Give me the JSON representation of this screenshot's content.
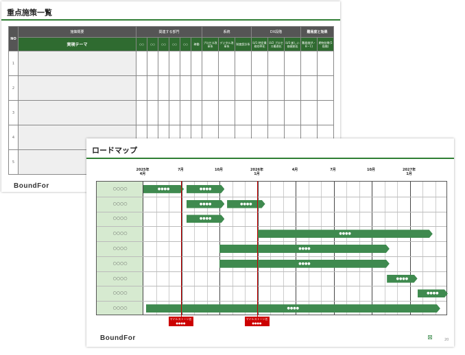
{
  "slide1": {
    "title": "重点施策一覧",
    "logo": "BoundFor",
    "headers": {
      "no": "NO",
      "measure": "施策概要",
      "theme": "実現テーマ",
      "dept": "関連する部門",
      "system": "系統",
      "dx": "DX段階",
      "difficulty": "難易度と効果"
    },
    "dept_cols": [
      "○○",
      "○○",
      "○○",
      "○○",
      "○○",
      "稼働"
    ],
    "system_cols": [
      "プロセス改革系",
      "デジタル改革系",
      "制度設計系"
    ],
    "dx_cols": [
      "LV1 特定業務効率化",
      "LV2 プロセス最適化",
      "LV3 新しい価値創出"
    ],
    "difficulty_cols": [
      "難易度(A・B・C)",
      "期待効果(5段階)"
    ],
    "rows": [
      "1",
      "2",
      "3",
      "4",
      "5"
    ]
  },
  "slide2": {
    "title": "ロードマップ",
    "logo": "BoundFor",
    "page_number": "20",
    "months": [
      "2025年\n4月",
      "7月",
      "10月",
      "2026年\n1月",
      "4月",
      "7月",
      "10月",
      "2027年\n1月"
    ],
    "row_labels": [
      "○○○○",
      "○○○○",
      "○○○○",
      "○○○○",
      "○○○○",
      "○○○○",
      "○○○○",
      "○○○○",
      "○○○○"
    ],
    "bars": [
      {
        "row": 0,
        "start": 0,
        "end": 3.2,
        "label": "●●●●"
      },
      {
        "row": 0,
        "start": 3.4,
        "end": 6.4,
        "label": "●●●●"
      },
      {
        "row": 1,
        "start": 3.4,
        "end": 6.4,
        "label": "●●●●"
      },
      {
        "row": 1,
        "start": 6.6,
        "end": 9.6,
        "label": "●●●●"
      },
      {
        "row": 2,
        "start": 3.4,
        "end": 6.4,
        "label": "●●●●"
      },
      {
        "row": 3,
        "start": 9.0,
        "end": 22.8,
        "label": "●●●●"
      },
      {
        "row": 4,
        "start": 6.0,
        "end": 19.4,
        "label": "●●●●"
      },
      {
        "row": 5,
        "start": 6.0,
        "end": 19.4,
        "label": "●●●●"
      },
      {
        "row": 6,
        "start": 19.2,
        "end": 21.6,
        "label": "●●●●"
      },
      {
        "row": 7,
        "start": 21.6,
        "end": 24.0,
        "label": "●●●●"
      },
      {
        "row": 8,
        "start": 0.2,
        "end": 23.4,
        "label": "●●●●"
      }
    ],
    "milestones": [
      {
        "at": 3.0,
        "label": "マイルストーン名",
        "sub": "●●●●"
      },
      {
        "at": 9.0,
        "label": "マイルストーン名",
        "sub": "●●●●"
      }
    ],
    "colors": {
      "bar": "#3f8a4f",
      "label_bg": "#d6ead0",
      "milestone": "#cc0000"
    }
  }
}
